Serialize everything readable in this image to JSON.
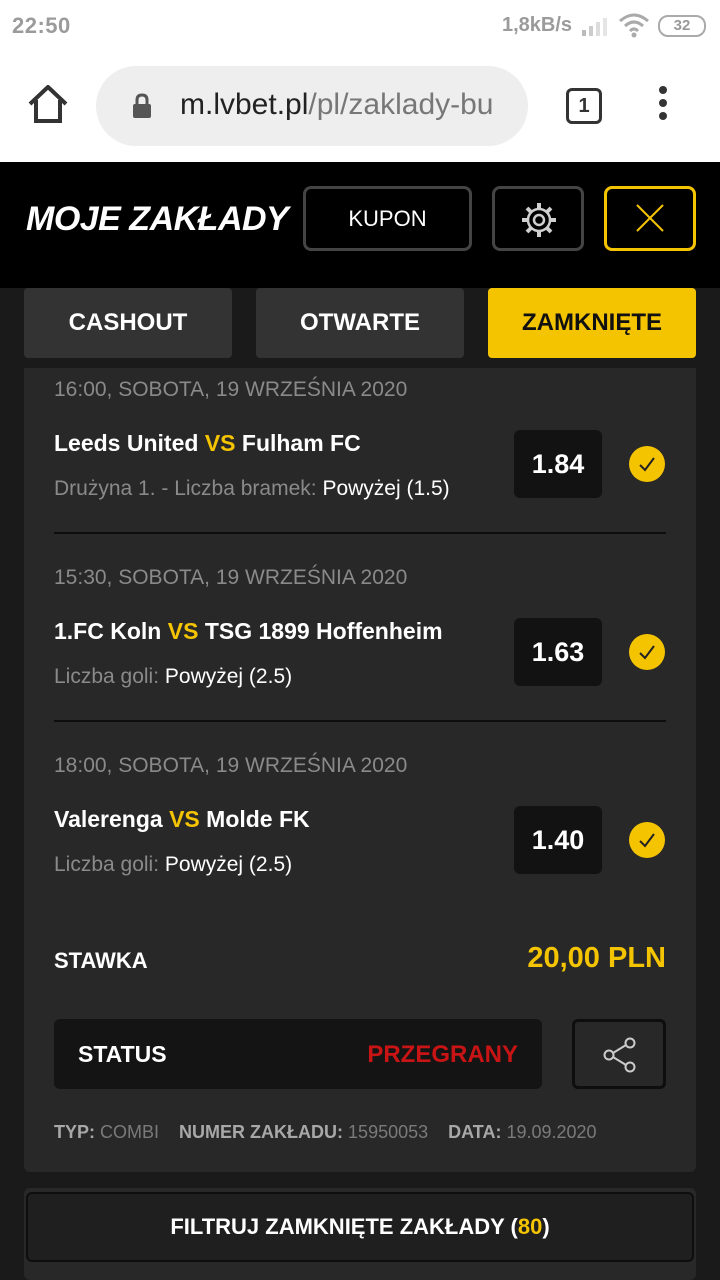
{
  "statusbar": {
    "time": "22:50",
    "net_speed": "1,8kB/s",
    "battery": "32"
  },
  "browser": {
    "url_host": "m.lvbet.pl",
    "url_path": "/pl/zaklady-bu",
    "tab_count": "1"
  },
  "header": {
    "title": "MOJE ZAKŁADY",
    "kupon_label": "KUPON"
  },
  "tabs": [
    {
      "label": "CASHOUT",
      "active": false
    },
    {
      "label": "OTWARTE",
      "active": false
    },
    {
      "label": "ZAMKNIĘTE",
      "active": true
    }
  ],
  "bets": [
    {
      "date": "16:00, SOBOTA, 19 WRZEŚNIA 2020",
      "home": "Leeds United",
      "vs": "VS",
      "away": "Fulham FC",
      "market": "Drużyna 1. - Liczba bramek:",
      "selection": "Powyżej (1.5)",
      "odds": "1.84"
    },
    {
      "date": "15:30, SOBOTA, 19 WRZEŚNIA 2020",
      "home": "1.FC Koln",
      "vs": "VS",
      "away": "TSG 1899 Hoffenheim",
      "market": "Liczba goli:",
      "selection": "Powyżej (2.5)",
      "odds": "1.63"
    },
    {
      "date": "18:00, SOBOTA, 19 WRZEŚNIA 2020",
      "home": "Valerenga",
      "vs": "VS",
      "away": "Molde FK",
      "market": "Liczba goli:",
      "selection": "Powyżej (2.5)",
      "odds": "1.40"
    }
  ],
  "stake": {
    "label": "STAWKA",
    "value": "20,00 PLN"
  },
  "status": {
    "label": "STATUS",
    "value": "PRZEGRANY"
  },
  "meta": {
    "type_label": "TYP:",
    "type_value": "COMBI",
    "number_label": "NUMER ZAKŁADU:",
    "number_value": "15950053",
    "date_label": "DATA:",
    "date_value": "19.09.2020"
  },
  "filter": {
    "label": "FILTRUJ ZAMKNIĘTE ZAKŁADY (",
    "count": "80",
    "suffix": ")"
  },
  "colors": {
    "accent": "#f5c400",
    "lost": "#c81414",
    "background": "#1a1a1a",
    "card": "#282828"
  }
}
